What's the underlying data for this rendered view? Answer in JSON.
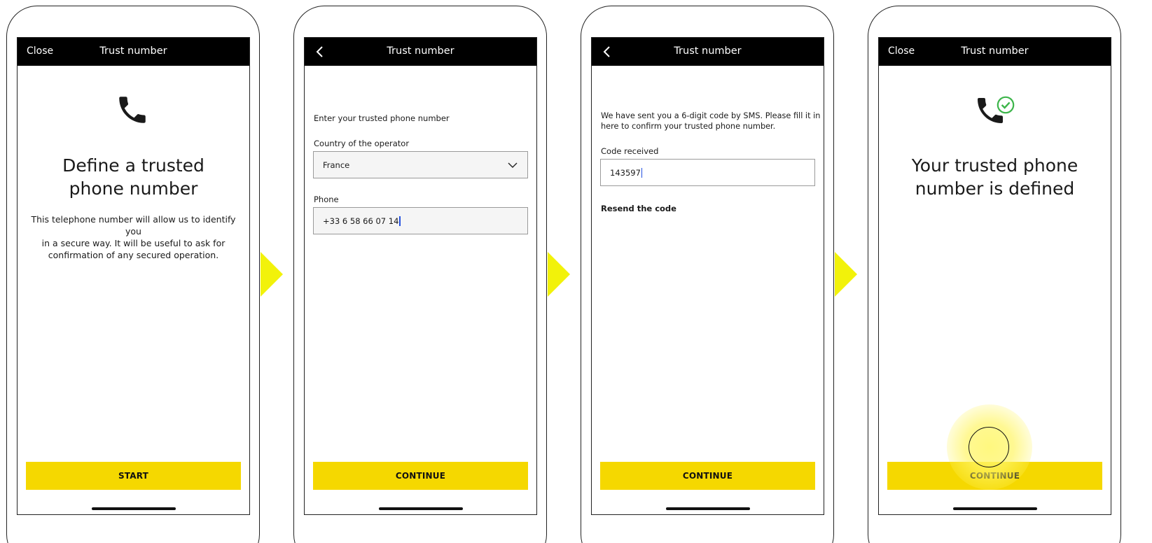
{
  "colors": {
    "accent": "#f5d800",
    "arrow": "#f2f20a",
    "topbar": "#000000",
    "success": "#3cb54a",
    "caret": "#2350e0"
  },
  "screen1": {
    "close_label": "Close",
    "title": "Trust number",
    "icon": "phone-icon",
    "heading_line1": "Define a trusted",
    "heading_line2": "phone number",
    "body_line1": "This telephone number will allow us to identify you",
    "body_line2": "in a secure way. It will be useful to ask for",
    "body_line3": "confirmation of any secured operation.",
    "button_label": "START"
  },
  "screen2": {
    "back_icon": "chevron-left-icon",
    "title": "Trust number",
    "intro": "Enter your trusted phone number",
    "country_label": "Country of the operator",
    "country_value": "France",
    "phone_label": "Phone",
    "phone_value": "+33 6 58 66 07 14",
    "button_label": "CONTINUE"
  },
  "screen3": {
    "back_icon": "chevron-left-icon",
    "title": "Trust number",
    "intro_line1": "We have sent you a 6-digit code by SMS. Please fill it in",
    "intro_line2": "here to confirm your trusted phone number.",
    "code_label": "Code received",
    "code_value": "143597",
    "resend_label": "Resend the code",
    "button_label": "CONTINUE"
  },
  "screen4": {
    "close_label": "Close",
    "title": "Trust number",
    "icon": "phone-check-icon",
    "heading_line1": "Your trusted phone",
    "heading_line2": "number is defined",
    "button_label": "CONTINUE"
  }
}
